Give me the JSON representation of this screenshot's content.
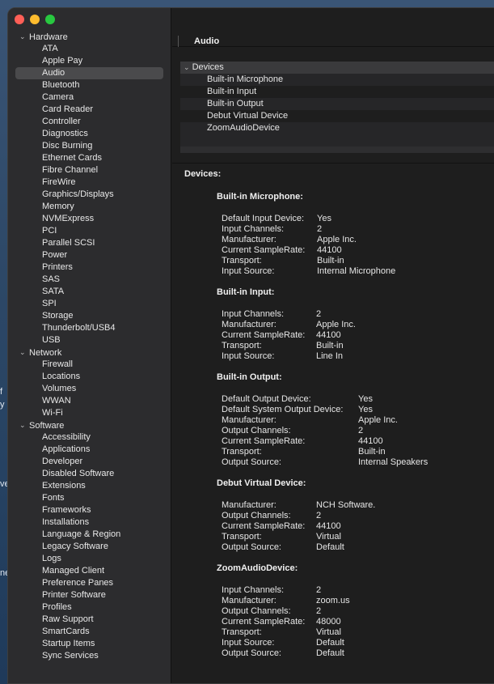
{
  "desktop_fragments": [
    "f",
    "y",
    "ve",
    "ne"
  ],
  "toolbar": {
    "title": "Audio"
  },
  "sidebar": {
    "groups": [
      {
        "label": "Hardware",
        "items": [
          "ATA",
          "Apple Pay",
          "Audio",
          "Bluetooth",
          "Camera",
          "Card Reader",
          "Controller",
          "Diagnostics",
          "Disc Burning",
          "Ethernet Cards",
          "Fibre Channel",
          "FireWire",
          "Graphics/Displays",
          "Memory",
          "NVMExpress",
          "PCI",
          "Parallel SCSI",
          "Power",
          "Printers",
          "SAS",
          "SATA",
          "SPI",
          "Storage",
          "Thunderbolt/USB4",
          "USB"
        ]
      },
      {
        "label": "Network",
        "items": [
          "Firewall",
          "Locations",
          "Volumes",
          "WWAN",
          "Wi-Fi"
        ]
      },
      {
        "label": "Software",
        "items": [
          "Accessibility",
          "Applications",
          "Developer",
          "Disabled Software",
          "Extensions",
          "Fonts",
          "Frameworks",
          "Installations",
          "Language & Region",
          "Legacy Software",
          "Logs",
          "Managed Client",
          "Preference Panes",
          "Printer Software",
          "Profiles",
          "Raw Support",
          "SmartCards",
          "Startup Items",
          "Sync Services"
        ]
      }
    ],
    "selected": "Audio"
  },
  "device_list": {
    "header": "Devices",
    "items": [
      "Built-in Microphone",
      "Built-in Input",
      "Built-in Output",
      "Debut Virtual Device",
      "ZoomAudioDevice"
    ]
  },
  "detail": {
    "title": "Devices:",
    "devices": [
      {
        "name": "Built-in Microphone:",
        "key_width": 118,
        "rows": [
          [
            "Default Input Device:",
            "Yes"
          ],
          [
            "Input Channels:",
            "2"
          ],
          [
            "Manufacturer:",
            "Apple Inc."
          ],
          [
            "Current SampleRate:",
            "44100"
          ],
          [
            "Transport:",
            "Built-in"
          ],
          [
            "Input Source:",
            "Internal Microphone"
          ]
        ]
      },
      {
        "name": "Built-in Input:",
        "key_width": 117,
        "rows": [
          [
            "Input Channels:",
            "2"
          ],
          [
            "Manufacturer:",
            "Apple Inc."
          ],
          [
            "Current SampleRate:",
            "44100"
          ],
          [
            "Transport:",
            "Built-in"
          ],
          [
            "Input Source:",
            "Line In"
          ]
        ]
      },
      {
        "name": "Built-in Output:",
        "key_width": 169,
        "rows": [
          [
            "Default Output Device:",
            "Yes"
          ],
          [
            "Default System Output Device:",
            "Yes"
          ],
          [
            "Manufacturer:",
            "Apple Inc."
          ],
          [
            "Output Channels:",
            "2"
          ],
          [
            "Current SampleRate:",
            "44100"
          ],
          [
            "Transport:",
            "Built-in"
          ],
          [
            "Output Source:",
            "Internal Speakers"
          ]
        ]
      },
      {
        "name": "Debut Virtual Device:",
        "key_width": 117,
        "rows": [
          [
            "Manufacturer:",
            "NCH Software."
          ],
          [
            "Output Channels:",
            "2"
          ],
          [
            "Current SampleRate:",
            "44100"
          ],
          [
            "Transport:",
            "Virtual"
          ],
          [
            "Output Source:",
            "Default"
          ]
        ]
      },
      {
        "name": "ZoomAudioDevice:",
        "key_width": 117,
        "rows": [
          [
            "Input Channels:",
            "2"
          ],
          [
            "Manufacturer:",
            "zoom.us"
          ],
          [
            "Output Channels:",
            "2"
          ],
          [
            "Current SampleRate:",
            "48000"
          ],
          [
            "Transport:",
            "Virtual"
          ],
          [
            "Input Source:",
            "Default"
          ],
          [
            "Output Source:",
            "Default"
          ]
        ]
      }
    ]
  }
}
